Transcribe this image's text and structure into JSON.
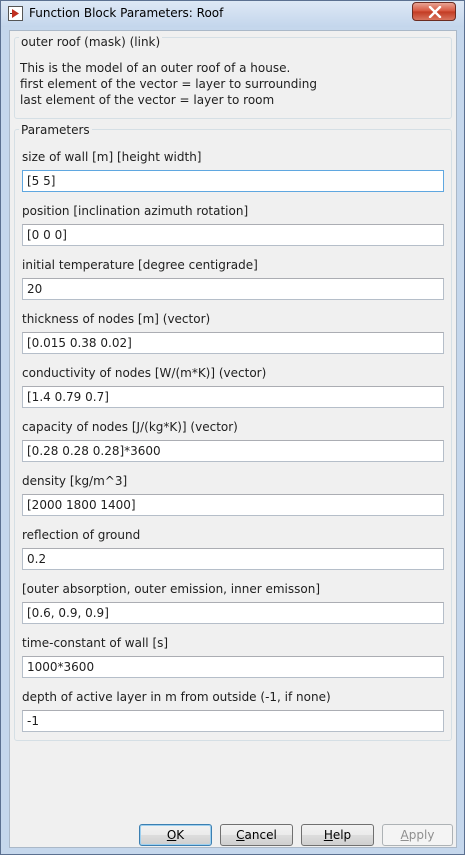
{
  "window": {
    "title": "Function Block Parameters: Roof"
  },
  "description": {
    "header": "outer roof (mask) (link)",
    "lines": [
      "This is the model of an outer roof of a house.",
      "first element of the vector = layer to surrounding",
      "last element of the vector = layer to room"
    ]
  },
  "parameters": {
    "header": "Parameters",
    "fields": [
      {
        "label": "size of wall [m] [height width]",
        "value": "[5 5]"
      },
      {
        "label": "position [inclination azimuth rotation]",
        "value": "[0 0 0]"
      },
      {
        "label": "initial temperature [degree centigrade]",
        "value": "20"
      },
      {
        "label": "thickness of nodes [m] (vector)",
        "value": "[0.015 0.38 0.02]"
      },
      {
        "label": "conductivity of nodes [W/(m*K)] (vector)",
        "value": "[1.4 0.79 0.7]"
      },
      {
        "label": "capacity of nodes [J/(kg*K)] (vector)",
        "value": "[0.28 0.28 0.28]*3600"
      },
      {
        "label": "density [kg/m^3]",
        "value": "[2000 1800 1400]"
      },
      {
        "label": "reflection of ground",
        "value": "0.2"
      },
      {
        "label": "[outer absorption, outer emission, inner emisson]",
        "value": "[0.6, 0.9, 0.9]"
      },
      {
        "label": "time-constant of wall [s]",
        "value": "1000*3600"
      },
      {
        "label": "depth of active layer in m from outside (-1, if none)",
        "value": "-1"
      }
    ]
  },
  "buttons": {
    "ok": {
      "first": "O",
      "rest": "K"
    },
    "cancel": {
      "first": "C",
      "rest": "ancel"
    },
    "help": {
      "first": "H",
      "rest": "elp"
    },
    "apply": {
      "first": "A",
      "rest": "pply"
    }
  }
}
